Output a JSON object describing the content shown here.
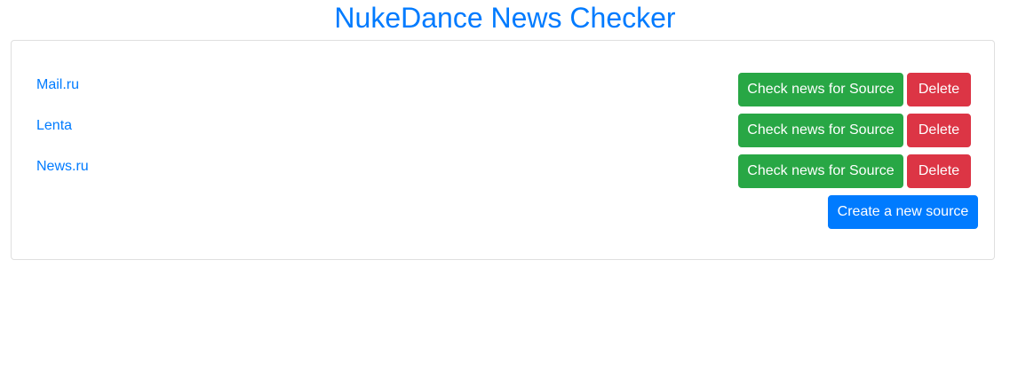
{
  "header": {
    "title": "NukeDance News Checker"
  },
  "sources": [
    {
      "name": "Mail.ru",
      "check_label": "Check news for Source",
      "delete_label": "Delete"
    },
    {
      "name": "Lenta",
      "check_label": "Check news for Source",
      "delete_label": "Delete"
    },
    {
      "name": "News.ru",
      "check_label": "Check news for Source",
      "delete_label": "Delete"
    }
  ],
  "actions": {
    "create_label": "Create a new source"
  },
  "colors": {
    "primary": "#007bff",
    "success": "#28a745",
    "danger": "#dc3545",
    "card_border": "#dfdfdf"
  }
}
